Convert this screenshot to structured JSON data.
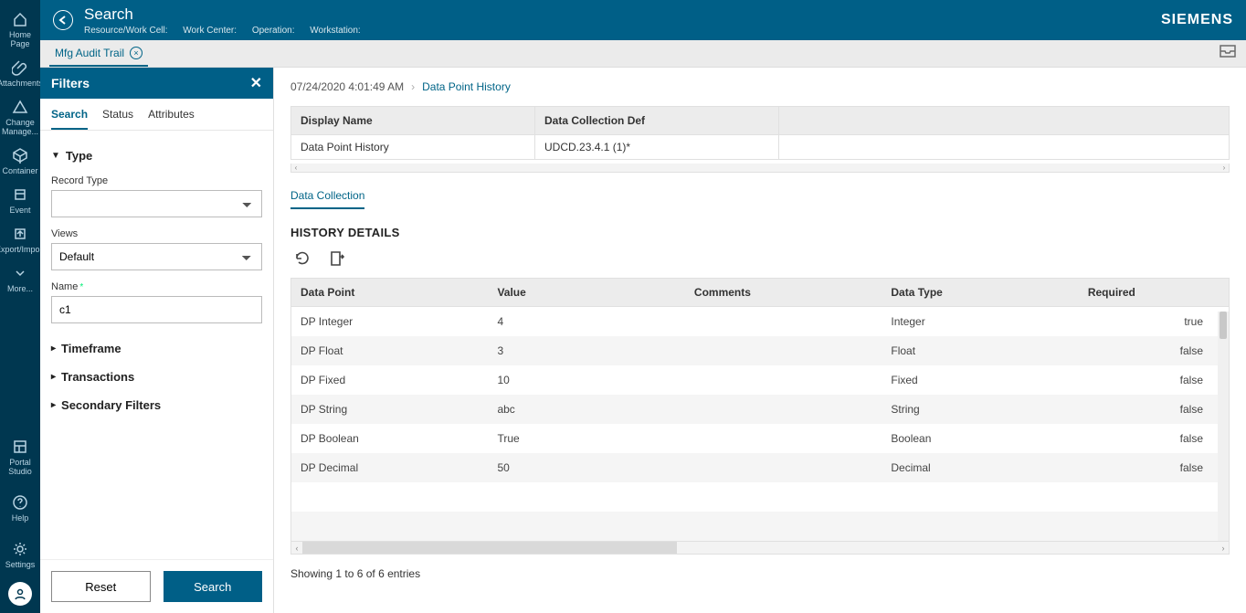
{
  "brand": "SIEMENS",
  "header": {
    "title": "Search",
    "crumbs": [
      "Resource/Work Cell:",
      "Work Center:",
      "Operation:",
      "Workstation:"
    ]
  },
  "tab": {
    "label": "Mfg Audit Trail"
  },
  "rail": {
    "items": [
      {
        "label": "Home Page"
      },
      {
        "label": "Attachments"
      },
      {
        "label": "Change Manage..."
      },
      {
        "label": "Container"
      },
      {
        "label": "Event"
      },
      {
        "label": "Export/Import"
      }
    ],
    "more": "More...",
    "bottom": [
      {
        "label": "Portal Studio"
      },
      {
        "label": "Help"
      },
      {
        "label": "Settings"
      }
    ]
  },
  "filters": {
    "title": "Filters",
    "tabs": [
      "Search",
      "Status",
      "Attributes"
    ],
    "type_section": "Type",
    "record_type_label": "Record Type",
    "record_type_value": "",
    "views_label": "Views",
    "views_value": "Default",
    "name_label": "Name",
    "name_value": "c1",
    "timeframe": "Timeframe",
    "transactions": "Transactions",
    "secondary": "Secondary Filters",
    "reset": "Reset",
    "search": "Search"
  },
  "breadcrumb": {
    "prev": "07/24/2020 4:01:49 AM",
    "current": "Data Point History"
  },
  "info": {
    "headers": [
      "Display Name",
      "Data Collection Def"
    ],
    "row": [
      "Data Point History",
      "UDCD.23.4.1 (1)*"
    ]
  },
  "sub_tab": "Data Collection",
  "history": {
    "title": "HISTORY DETAILS",
    "columns": [
      "Data Point",
      "Value",
      "Comments",
      "Data Type",
      "Required"
    ],
    "rows": [
      {
        "dp": "DP Integer",
        "val": "4",
        "cmt": "",
        "type": "Integer",
        "req": "true"
      },
      {
        "dp": "DP Float",
        "val": "3",
        "cmt": "",
        "type": "Float",
        "req": "false"
      },
      {
        "dp": "DP Fixed",
        "val": "10",
        "cmt": "",
        "type": "Fixed",
        "req": "false"
      },
      {
        "dp": "DP String",
        "val": "abc",
        "cmt": "",
        "type": "String",
        "req": "false"
      },
      {
        "dp": "DP Boolean",
        "val": "True",
        "cmt": "",
        "type": "Boolean",
        "req": "false"
      },
      {
        "dp": "DP Decimal",
        "val": "50",
        "cmt": "",
        "type": "Decimal",
        "req": "false"
      }
    ],
    "blank_rows": 2,
    "footer": "Showing 1 to 6 of 6 entries"
  }
}
